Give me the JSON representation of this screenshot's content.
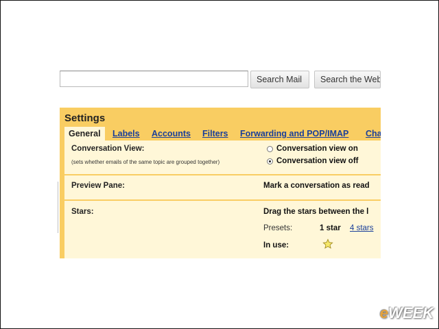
{
  "search": {
    "value": "",
    "search_mail_label": "Search Mail",
    "search_web_label": "Search the Web"
  },
  "settings": {
    "title": "Settings",
    "tabs": [
      {
        "label": "General",
        "active": true
      },
      {
        "label": "Labels"
      },
      {
        "label": "Accounts"
      },
      {
        "label": "Filters"
      },
      {
        "label": "Forwarding and POP/IMAP"
      },
      {
        "label": "Cha"
      }
    ],
    "conversation_view": {
      "label": "Conversation View:",
      "hint": "(sets whether emails of the same topic are grouped together)",
      "options": [
        {
          "label": "Conversation view on",
          "checked": false
        },
        {
          "label": "Conversation view off",
          "checked": true
        }
      ]
    },
    "preview_pane": {
      "label": "Preview Pane:",
      "value": "Mark a conversation as read"
    },
    "stars": {
      "label": "Stars:",
      "description": "Drag the stars between the l",
      "presets_label": "Presets:",
      "preset_1": "1 star",
      "preset_4": "4 stars",
      "in_use_label": "In use:",
      "in_use_icon": "star-icon"
    }
  },
  "watermark": {
    "text_e": "e",
    "text_rest": "WEEK"
  },
  "colors": {
    "settings_bg": "#f9cd62",
    "panel_bg": "#fff7d8",
    "link": "#1a3f9a"
  }
}
